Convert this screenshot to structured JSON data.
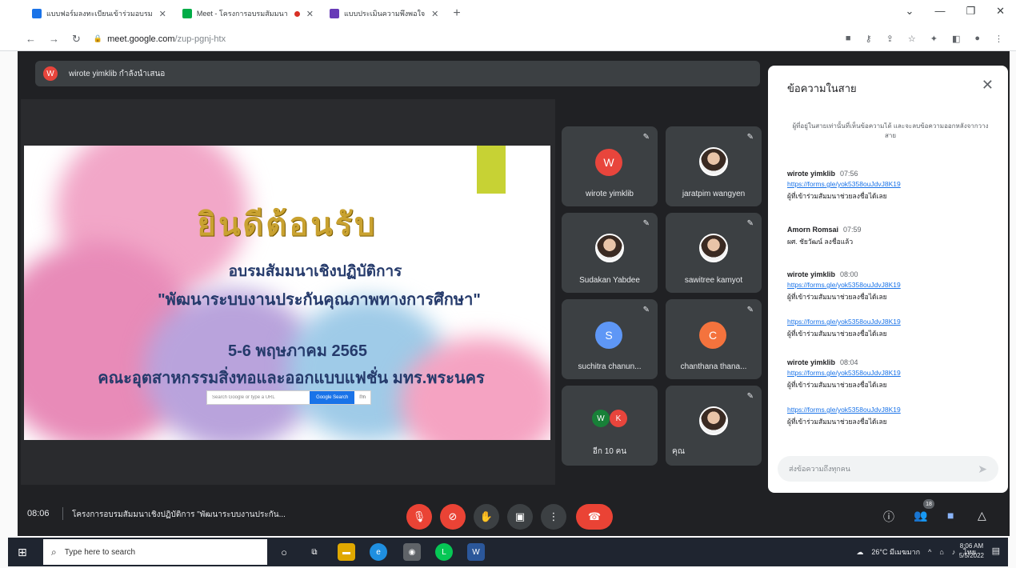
{
  "browser": {
    "tabs": [
      {
        "label": "แบบฟอร์มลงทะเบียนเข้าร่วมอบรม",
        "color": "#1a73e8",
        "recording": false
      },
      {
        "label": "Meet - โครงการอบรมสัมมนา",
        "color": "#00ac47",
        "recording": true
      },
      {
        "label": "แบบประเมินความพึงพอใจ",
        "color": "#673ab7",
        "recording": false
      }
    ],
    "new_tab": "+",
    "url_host": "meet.google.com",
    "url_path": "/zup-pgnj-htx",
    "nav_back": "←",
    "nav_forward": "→",
    "nav_reload": "↻"
  },
  "meet": {
    "presenter_initial": "W",
    "presenter_text": "wirote yimklib กำลังนำเสนอ",
    "slide": {
      "title": "ยินดีต้อนรับ",
      "line2": "อบรมสัมมนาเชิงปฏิบัติการ",
      "line3": "\"พัฒนาระบบงานประกันคุณภาพทางการศึกษา\"",
      "line4": "5-6 พฤษภาคม 2565",
      "line5": "คณะอุตสาหกรรมสิ่งทอและออกแบบแฟชั่น มทร.พระนคร",
      "search_placeholder": "Search Google or type a URL",
      "search_btn": "Google Search",
      "search_btn2": "I'm"
    },
    "participants": [
      {
        "name": "wirote yimklib",
        "initial": "W",
        "color": "#e8453c"
      },
      {
        "name": "jaratpim wangyen",
        "initial": "",
        "color": ""
      },
      {
        "name": "Sudakan Yabdee",
        "initial": "",
        "color": ""
      },
      {
        "name": "sawitree kamyot",
        "initial": "",
        "color": ""
      },
      {
        "name": "suchitra chanun...",
        "initial": "S",
        "color": "#5e97f6"
      },
      {
        "name": "chanthana thana...",
        "initial": "C",
        "color": "#f4733d"
      },
      {
        "name": "อีก 10 คน",
        "initial_a": "W",
        "initial_b": "K",
        "color_a": "#188038",
        "color_b": "#e8453c"
      },
      {
        "name": "คุณ",
        "initial": "",
        "color": ""
      }
    ],
    "chat": {
      "title": "ข้อความในสาย",
      "close": "✕",
      "notice": "ผู้ที่อยู่ในสายเท่านั้นที่เห็นข้อความได้ และจะลบข้อความออกหลังจากวางสาย",
      "messages": [
        {
          "author": "wirote yimklib",
          "time": "07:56",
          "link": "https://forms.gle/yok5358ouJdvJ8K19",
          "body": "ผู้ที่เข้าร่วมสัมมนาช่วยลงชื่อได้เลย"
        },
        {
          "author": "Amorn Romsai",
          "time": "07:59",
          "link": "",
          "body": "ผศ. ชัยวัฒน์ ลงชื่อแล้ว"
        },
        {
          "author": "wirote yimklib",
          "time": "08:00",
          "link": "https://forms.gle/yok5358ouJdvJ8K19",
          "body": "ผู้ที่เข้าร่วมสัมมนาช่วยลงชื่อได้เลย"
        },
        {
          "author": "",
          "time": "",
          "link": "https://forms.gle/yok5358ouJdvJ8K19",
          "body": "ผู้ที่เข้าร่วมสัมมนาช่วยลงชื่อได้เลย"
        },
        {
          "author": "wirote yimklib",
          "time": "08:04",
          "link": "https://forms.gle/yok5358ouJdvJ8K19",
          "body": "ผู้ที่เข้าร่วมสัมมนาช่วยลงชื่อได้เลย"
        },
        {
          "author": "",
          "time": "",
          "link": "https://forms.gle/yok5358ouJdvJ8K19",
          "body": "ผู้ที่เข้าร่วมสัมมนาช่วยลงชื่อได้เลย"
        }
      ],
      "input_placeholder": "ส่งข้อความถึงทุกคน",
      "send": "➤"
    },
    "controls": {
      "time": "08:06",
      "meeting_title": "โครงการอบรมสัมมนาเชิงปฏิบัติการ \"พัฒนาระบบงานประกัน...",
      "mic_icon": "🎙",
      "cam_icon": "⊘",
      "hand_icon": "✋",
      "present_icon": "▣",
      "more_icon": "⋮",
      "end_icon": "☎",
      "info_icon": "ⓘ",
      "people_icon": "👥",
      "people_count": "18",
      "chat_icon": "■",
      "activities_icon": "△"
    }
  },
  "taskbar": {
    "start_icon": "⊞",
    "search_placeholder": "Type here to search",
    "weather": "26°C มีเมฆมาก",
    "lang": "ไทย",
    "time": "8:06 AM",
    "date": "5/5/2022"
  }
}
